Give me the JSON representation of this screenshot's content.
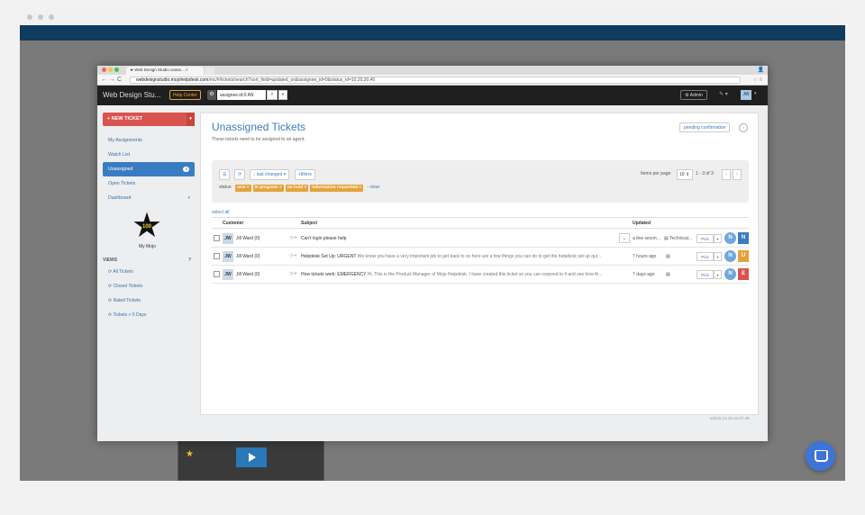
{
  "browser": {
    "tab_title": "Web Design Studio unass...",
    "url_host": "webdesignstudio.mojohelpdesk.com",
    "url_path": "/mc/#/tickets/search?sort_field=updated_on&assignee_id=0&status_id=10,20,30,40"
  },
  "appbar": {
    "brand": "Web Design Stu...",
    "help_center": "Help Center",
    "search_value": "assignee.id:0 AN",
    "admin": "Admin",
    "avatar": "JW"
  },
  "sidebar": {
    "new_ticket": "NEW TICKET",
    "items": [
      {
        "label": "My Assignments"
      },
      {
        "label": "Watch List"
      },
      {
        "label": "Unassigned",
        "count": "3"
      },
      {
        "label": "Open Tickets"
      },
      {
        "label": "Dashboard"
      }
    ],
    "badge_number": "100",
    "badge_label": "My Mojo",
    "views_heading": "VIEWS",
    "views": [
      {
        "label": "All Tickets"
      },
      {
        "label": "Closed Tickets"
      },
      {
        "label": "Rated Tickets"
      },
      {
        "label": "Tickets > 5 Days"
      }
    ]
  },
  "main": {
    "title": "Unassigned Tickets",
    "subtitle": "These tickets need to be assigned to an agent.",
    "pending_button": "pending confirmation",
    "sort_label": "↓ last changed",
    "filters_label": "+filters",
    "status_label": "status:",
    "status_tags": [
      "new ×",
      "in progress ×",
      "on hold ×",
      "information requested ×"
    ],
    "clear_label": "- clear",
    "items_per_page_label": "Items per page",
    "items_per_page_value": "10",
    "pager_text": "1 - 3 of 3",
    "select_all": "select all",
    "columns": {
      "customer": "Customer",
      "subject": "Subject",
      "updated": "Updated"
    },
    "rows": [
      {
        "initials": "JW",
        "customer": "Jill Ward (0)",
        "subject": "Can't login please help",
        "preview": "",
        "updated": "a few secon...",
        "category": "Technical...",
        "pick": "Pick",
        "assignee": "N",
        "priority": "N",
        "priority_color": "#3a7cc1"
      },
      {
        "initials": "JW",
        "customer": "Jill Ward (0)",
        "subject": "Helpdesk Set Up: URGENT",
        "preview": "We know you have a very important job to get back to so here are a few things you can do to get the helpdesk set up qui...",
        "updated": "7 hours ago",
        "category": "",
        "pick": "Pick",
        "assignee": "N",
        "priority": "U",
        "priority_color": "#e6a23c"
      },
      {
        "initials": "JW",
        "customer": "Jill Ward (0)",
        "subject": "How tickets work: EMERGENCY",
        "preview": "Hi, This is the Product Manager of Mojo Helpdesk. I have created this ticket so you can respond to it and see how th...",
        "updated": "7 days ago",
        "category": "",
        "pick": "Pick",
        "assignee": "N",
        "priority": "E",
        "priority_color": "#d9534f"
      }
    ],
    "version": "v2015.12.15.14.37.46"
  }
}
